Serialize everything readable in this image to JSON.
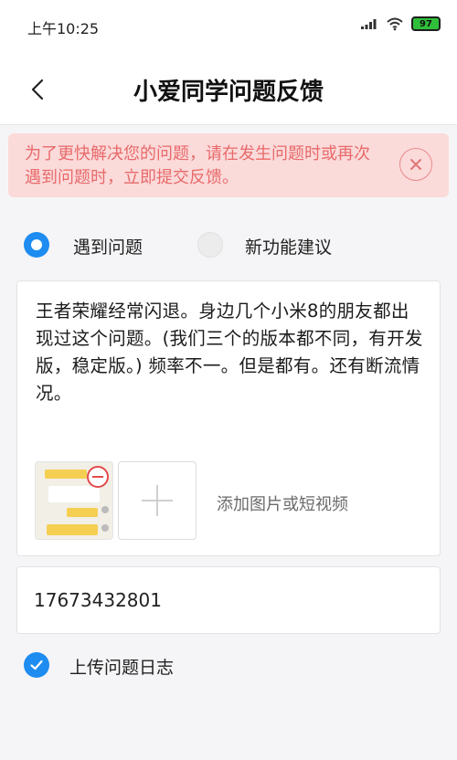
{
  "status_bar": {
    "time": "上午10:25",
    "battery_level": "97",
    "icons": [
      "signal-icon",
      "wifi-icon",
      "battery-icon"
    ]
  },
  "header": {
    "title": "小爱同学问题反馈",
    "back_icon": "chevron-left-icon"
  },
  "notice": {
    "text": "为了更快解决您的问题，请在发生问题时或再次遇到问题时，立即提交反馈。",
    "close_icon": "close-icon"
  },
  "feedback_type": {
    "options": [
      {
        "label": "遇到问题",
        "selected": true
      },
      {
        "label": "新功能建议",
        "selected": false
      }
    ]
  },
  "feedback": {
    "text": "王者荣耀经常闪退。身边几个小米8的朋友都出现过这个问题。(我们三个的版本都不同，有开发版，稳定版。) 频率不一。但是都有。还有断流情况。",
    "add_media_label": "添加图片或短视频",
    "remove_icon": "minus-circle-icon",
    "add_icon": "plus-icon"
  },
  "contact": {
    "phone": "17673432801"
  },
  "upload_log": {
    "label": "上传问题日志",
    "checked": true
  },
  "colors": {
    "accent": "#1e8cf0",
    "notice_bg": "#fbdada",
    "notice_text": "#e86a6a",
    "remove": "#e34a4a"
  }
}
